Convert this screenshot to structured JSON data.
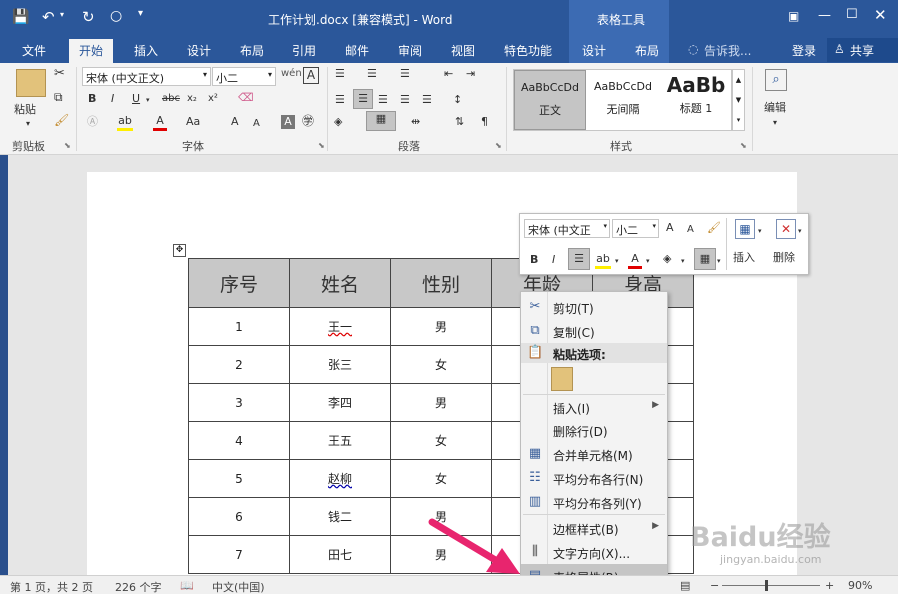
{
  "titlebar": {
    "doc_title": "工作计划.docx [兼容模式] - Word",
    "context_title": "表格工具"
  },
  "tabs": [
    "文件",
    "开始",
    "插入",
    "设计",
    "布局",
    "引用",
    "邮件",
    "审阅",
    "视图",
    "特色功能",
    "设计",
    "布局"
  ],
  "tell_me": "告诉我...",
  "login": "登录",
  "share": "共享",
  "ribbon": {
    "clipboard": {
      "paste": "粘贴",
      "group": "剪贴板"
    },
    "font": {
      "name": "宋体 (中文正文)",
      "size": "小二",
      "group": "字体"
    },
    "paragraph": {
      "group": "段落"
    },
    "styles": {
      "group": "样式",
      "items": [
        {
          "preview": "AaBbCcDd",
          "name": "正文"
        },
        {
          "preview": "AaBbCcDd",
          "name": "无间隔"
        },
        {
          "preview": "AaBb",
          "name": "标题 1"
        }
      ]
    },
    "editing": {
      "label": "编辑"
    }
  },
  "table": {
    "headers": [
      "序号",
      "姓名",
      "性别",
      "年龄",
      "身高"
    ],
    "rows": [
      [
        "1",
        "王一",
        "男"
      ],
      [
        "2",
        "张三",
        "女"
      ],
      [
        "3",
        "李四",
        "男"
      ],
      [
        "4",
        "王五",
        "女"
      ],
      [
        "5",
        "赵柳",
        "女"
      ],
      [
        "6",
        "钱二",
        "男"
      ],
      [
        "7",
        "田七",
        "男"
      ]
    ]
  },
  "mini_toolbar": {
    "font": "宋体 (中文正",
    "size": "小二",
    "insert": "插入",
    "delete": "删除"
  },
  "context_menu": [
    {
      "label": "剪切(T)",
      "icon": "scissors-icon"
    },
    {
      "label": "复制(C)",
      "icon": "copy-icon"
    },
    {
      "label": "粘贴选项:",
      "icon": "paste-icon",
      "header": true
    },
    {
      "label": "",
      "icon": "paste-keep-icon"
    },
    {
      "label": "插入(I)",
      "submenu": true
    },
    {
      "label": "删除行(D)"
    },
    {
      "label": "合并单元格(M)",
      "icon": "merge-cells-icon"
    },
    {
      "label": "平均分布各行(N)",
      "icon": "distribute-rows-icon"
    },
    {
      "label": "平均分布各列(Y)",
      "icon": "distribute-columns-icon"
    },
    {
      "label": "边框样式(B)",
      "submenu": true
    },
    {
      "label": "文字方向(X)...",
      "icon": "text-direction-icon"
    },
    {
      "label": "表格属性(R)...",
      "icon": "table-properties-icon",
      "highlight": true
    }
  ],
  "statusbar": {
    "page": "第 1 页，共 2 页",
    "words": "226 个字",
    "language": "中文(中国)",
    "zoom": "90%",
    "zoom_level": 0.9
  },
  "watermark": "Baidu经验",
  "watermark_url": "jingyan.baidu.com",
  "colors": {
    "accent": "#2b579a",
    "highlight": "#c5c5c5",
    "arrow": "#e8256e"
  }
}
